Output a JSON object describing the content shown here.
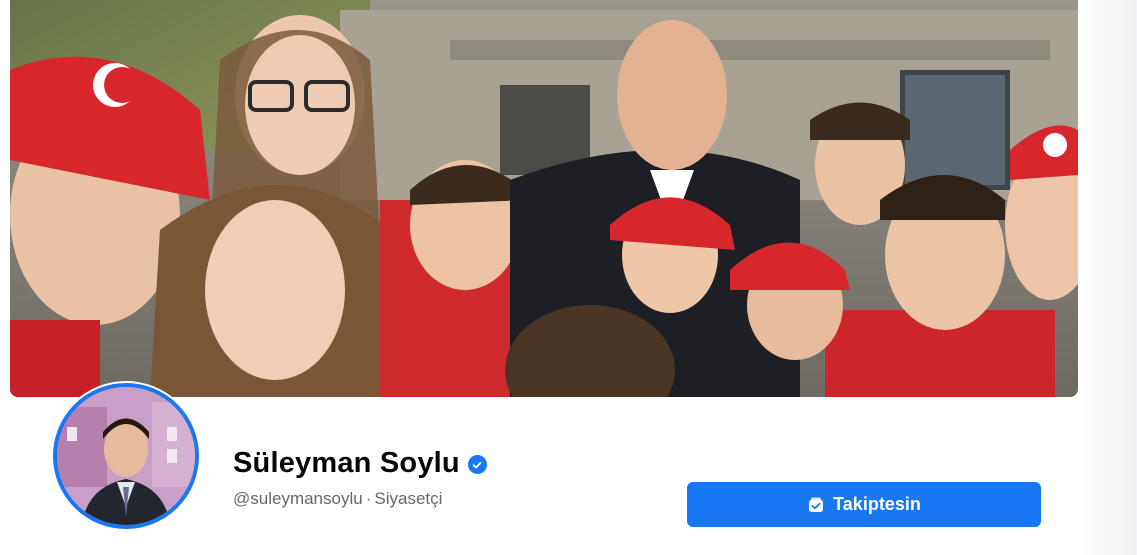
{
  "profile": {
    "name": "Süleyman Soylu",
    "verified": true,
    "handle": "@suleymansoylu",
    "separator": "·",
    "category": "Siyasetçi"
  },
  "actions": {
    "follow_label": "Takiptesin",
    "follow_icon": "following-check-icon"
  },
  "cover_photo": {
    "alt": "cover-photo"
  },
  "colors": {
    "accent": "#1877f2",
    "name_text": "#050505",
    "secondary_text": "#65676b",
    "cap_red": "#d8262d"
  }
}
